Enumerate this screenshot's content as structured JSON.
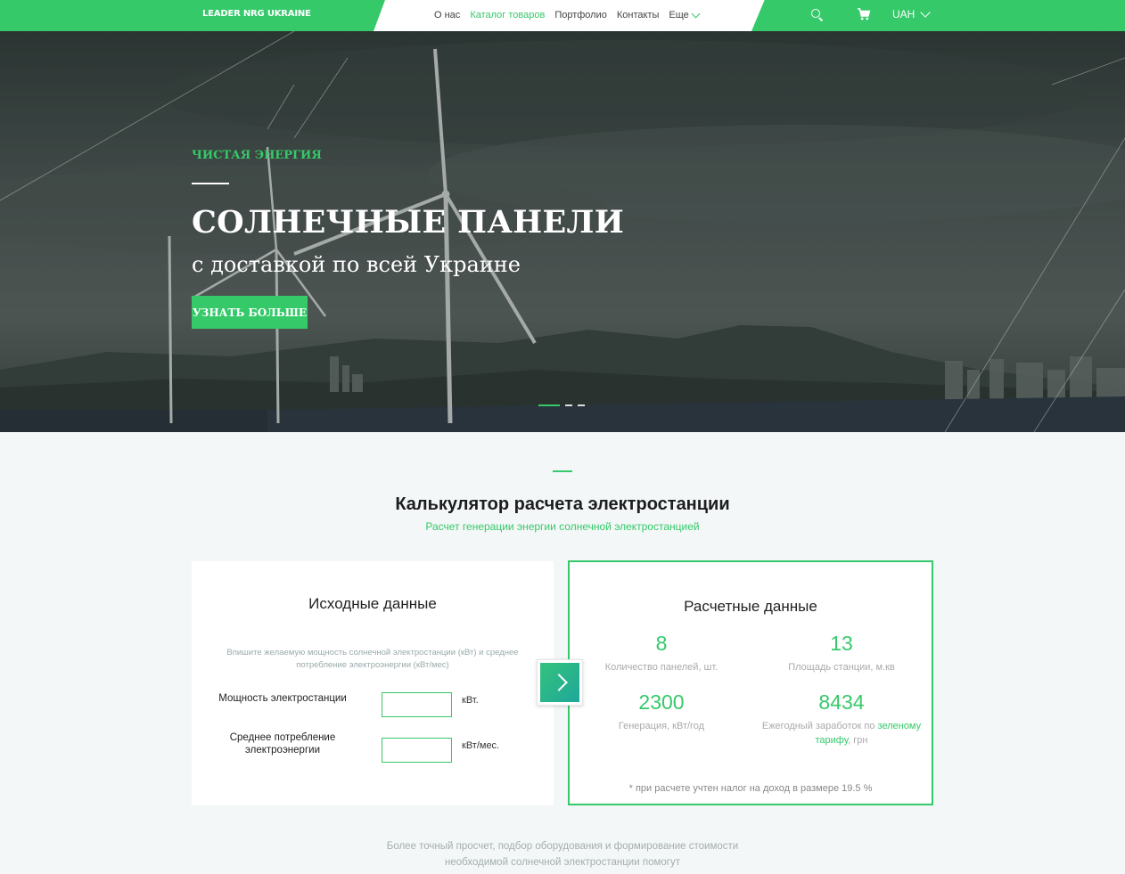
{
  "header": {
    "logo": "LEADER NRG UKRAINE",
    "nav": [
      {
        "label": "О нас"
      },
      {
        "label": "Каталог товаров"
      },
      {
        "label": "Портфолио"
      },
      {
        "label": "Контакты"
      }
    ],
    "more_label": "Еще",
    "currency": "UAH",
    "icons": [
      "search-icon",
      "cart-icon",
      "chevron-down-icon"
    ]
  },
  "hero": {
    "tag": "ЧИСТАЯ ЭНЕРГИЯ",
    "title": "СОЛНЕЧНЫЕ ПАНЕЛИ",
    "subtitle": "с доставкой по всей Украине",
    "button": "УЗНАТЬ БОЛЬШЕ",
    "slides": 3,
    "active_slide": 1
  },
  "calculator": {
    "title": "Калькулятор расчета электростанции",
    "subtitle": "Расчет генерации энергии солнечной электростанцией",
    "input_card": {
      "title": "Исходные данные",
      "hint": "Впишите желаемую мощность солнечной электростанции (кВт) и среднее потребление электроэнергии (кВт/мес)",
      "power_label": "Мощность электростанции",
      "power_value": "",
      "power_unit": "кВт.",
      "consumption_label": "Среднее потребление электроэнергии",
      "consumption_value": "",
      "consumption_unit": "кВт/мес."
    },
    "result_card": {
      "title": "Расчетные данные",
      "panels_value": "8",
      "panels_label": "Количество панелей, шт.",
      "area_value": "13",
      "area_label": "Площадь станции, м.кв",
      "generation_value": "2300",
      "generation_label": "Генерация, кВт/год",
      "earnings_value": "8434",
      "earnings_label_pre": "Ежегодный заработок по ",
      "earnings_label_link": "зеленому тарифу",
      "earnings_label_post": ", грн",
      "footnote": "* при расчете учтен налог на доход в размере 19.5 %"
    },
    "bottom_text": "Более точный просчет, подбор оборудования и формирование стоимости необходимой солнечной электростанции помогут"
  },
  "colors": {
    "accent": "#36c96a",
    "hero_overlay": "#3f4846",
    "page_bg": "#f3f7f7"
  }
}
